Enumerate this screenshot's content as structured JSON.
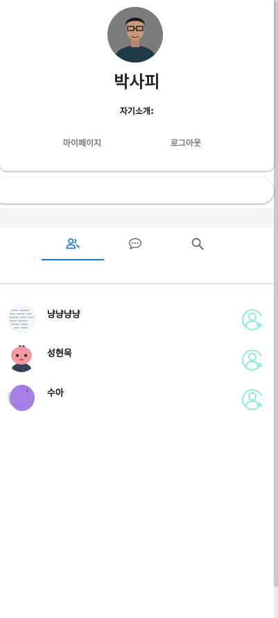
{
  "profile": {
    "name": "박사피",
    "bio_label": "자기소개:",
    "mypage_label": "마이페이지",
    "logout_label": "로그아웃"
  },
  "tabs": [
    {
      "icon": "friends-icon",
      "active": true
    },
    {
      "icon": "chat-bubble-icon",
      "active": false
    },
    {
      "icon": "search-icon",
      "active": false
    }
  ],
  "friends": [
    {
      "name": "냥냥냥냥",
      "avatar": "text-pattern-avatar"
    },
    {
      "name": "성현욱",
      "avatar": "pink-cartoon-avatar"
    },
    {
      "name": "수아",
      "avatar": "purple-blob-avatar"
    }
  ],
  "colors": {
    "accent": "#1976d2",
    "friend_action": "#8eead8",
    "tab_icon": "#6b6b6b"
  }
}
